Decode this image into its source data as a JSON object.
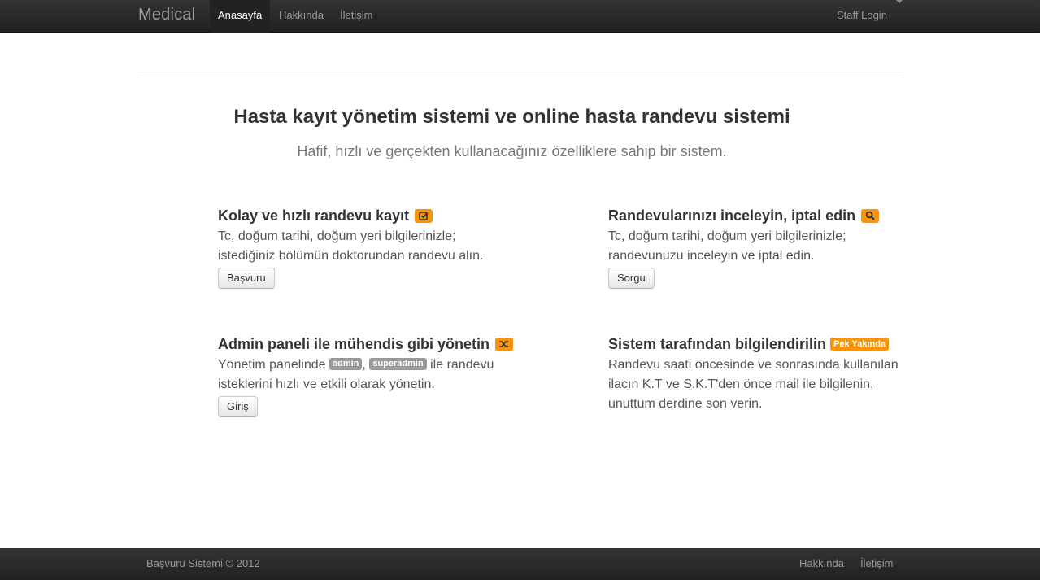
{
  "navbar": {
    "brand": "Medical",
    "items": [
      {
        "label": "Anasayfa",
        "active": true
      },
      {
        "label": "Hakkında",
        "active": false
      },
      {
        "label": "İletişim",
        "active": false
      }
    ],
    "staff_login": "Staff Login"
  },
  "hero": {
    "title": "Hasta kayıt yönetim sistemi ve online hasta randevu sistemi",
    "subtitle": "Hafif, hızlı ve gerçekten kullanacağınız özelliklere sahip bir sistem."
  },
  "features": [
    {
      "title": "Kolay ve hızlı randevu kayıt",
      "icon": "check-square-icon",
      "line1": "Tc, doğum tarihi, doğum yeri bilgilerinizle;",
      "line2": "istediğiniz bölümün doktorundan randevu alın.",
      "button": "Başvuru"
    },
    {
      "title": "Randevularınızı inceleyin, iptal edin",
      "icon": "search-icon",
      "line1": "Tc, doğum tarihi, doğum yeri bilgilerinizle;",
      "line2": "randevunuzu inceleyin ve iptal edin.",
      "button": "Sorgu"
    },
    {
      "title": "Admin paneli ile mühendis gibi yönetin",
      "icon": "shuffle-icon",
      "text_before": "Yönetim panelinde",
      "badge1": "admin",
      "separator": ",",
      "badge2": "superadmin",
      "text_after": "ile randevu",
      "line2": "isteklerini hızlı ve etkili olarak yönetin.",
      "button": "Giriş"
    },
    {
      "title": "Sistem tarafından bilgilendirilin",
      "badge": "Pek Yakında",
      "line1": "Randevu saati öncesinde ve sonrasında kullanılan",
      "line2": "ilacın K.T ve S.K.T'den önce mail ile bilgilenin,",
      "line3": "unuttum derdine son verin."
    }
  ],
  "footer": {
    "copyright": "Başvuru Sistemi © 2012",
    "links": [
      "Hakkında",
      "İletişim"
    ]
  },
  "colors": {
    "navbar": "#222222",
    "accent": "#f89406",
    "badge_gray": "#999999"
  }
}
